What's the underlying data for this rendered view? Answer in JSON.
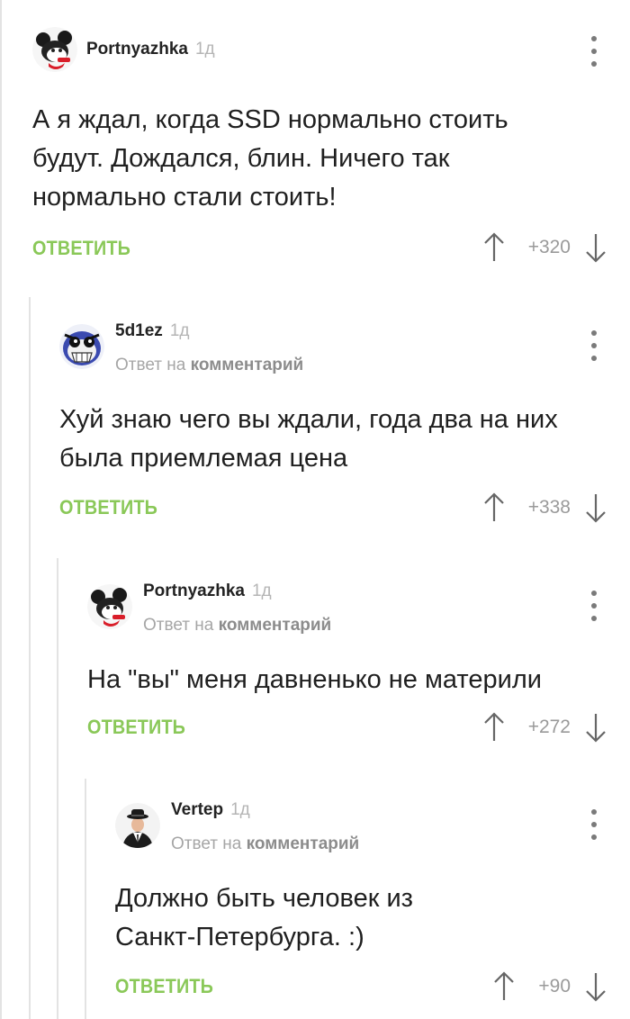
{
  "colors": {
    "accent": "#8ac858",
    "thread_line": "#e3e3e3",
    "muted": "#a6a6a6"
  },
  "icons": {
    "menu": "kebab-vertical",
    "upvote": "arrow-up",
    "downvote": "arrow-down"
  },
  "comments": [
    {
      "author": "Portnyazhka",
      "time": "1д",
      "avatar": "mouse-avatar",
      "reply_prefix": "",
      "reply_target": "",
      "text": "А я ждал, когда SSD нормально стоить\nбудут. Дождался, блин. Ничего так\nнормально стали стоить!",
      "reply_label": "ОТВЕТИТЬ",
      "rating": "+320"
    },
    {
      "author": "5d1ez",
      "time": "1д",
      "avatar": "bird-avatar",
      "reply_prefix": "Ответ на",
      "reply_target": "комментарий",
      "text": "Хуй знаю чего вы ждали, года два на них\nбыла приемлемая цена",
      "reply_label": "ОТВЕТИТЬ",
      "rating": "+338"
    },
    {
      "author": "Portnyazhka",
      "time": "1д",
      "avatar": "mouse-avatar",
      "reply_prefix": "Ответ на",
      "reply_target": "комментарий",
      "text": "На \"вы\" меня давненько не материли",
      "reply_label": "ОТВЕТИТЬ",
      "rating": "+272"
    },
    {
      "author": "Vertep",
      "time": "1д",
      "avatar": "man-in-hat-avatar",
      "reply_prefix": "Ответ на",
      "reply_target": "комментарий",
      "text": "Должно быть человек из\nСанкт-Петербурга. :)",
      "reply_label": "ОТВЕТИТЬ",
      "rating": "+90"
    }
  ]
}
